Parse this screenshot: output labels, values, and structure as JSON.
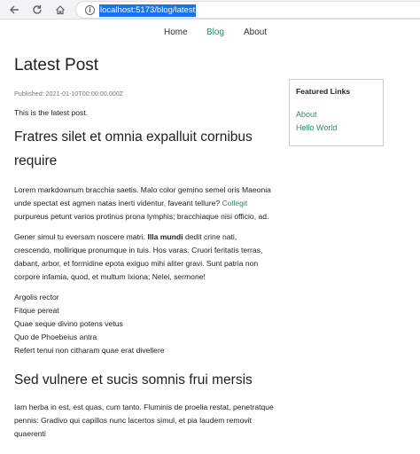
{
  "browser": {
    "url": "localhost:5173/blog/latest"
  },
  "site_nav": {
    "items": [
      {
        "label": "Home",
        "active": false
      },
      {
        "label": "Blog",
        "active": true
      },
      {
        "label": "About",
        "active": false
      }
    ]
  },
  "post": {
    "title": "Latest Post",
    "published": "Published: 2021-01-10T00:00:00.000Z",
    "intro": "This is the latest post.",
    "heading1": "Fratres silet et omnia expalluit cornibus require",
    "p1_before_link": "Lorem markdownum bracchia saetis. Malo color gemino semel oris Maeonia unde spectat est agmen natas inerti videntur, faveant tellure? ",
    "p1_link": "Collegit",
    "p1_after_link": " purpureus petunt varios protinus prona lymphis; bracchiaque nisi officio, ad.",
    "p2_before_bold": "Gener simul tu eversam noscere matri. ",
    "p2_bold": "Illa mundi",
    "p2_after_bold": " dedit crine nati, crescendo, mollirique pronumque in tuis. Hos varas. Cruori feritatis terras, dabant, arbor, et formidine epota exiguo mihi aliter gravi. Sunt patria non corpore infamia, quod, et multum Ixiona; Nelei, sermone!",
    "lines": [
      "Argolis rector",
      "Fitque pereat",
      "Quae seque divino potens vetus",
      "Quo de Phoebeius antra",
      "Refert tenui non citharam quae erat divellere"
    ],
    "heading2": "Sed vulnere et sucis somnis frui mersis",
    "p3": "Iam herba in est, est quas, cum tanto. Fluminis de proelia restat, penetratque pennis: Gradivo qui capillos nunc lacertos simul, et pia laudem removit quaerenti"
  },
  "sidebar": {
    "title": "Featured Links",
    "links": [
      "About",
      "Hello World"
    ]
  },
  "colors": {
    "accent": "#2e8b57",
    "url_highlight": "#1a73e8"
  }
}
